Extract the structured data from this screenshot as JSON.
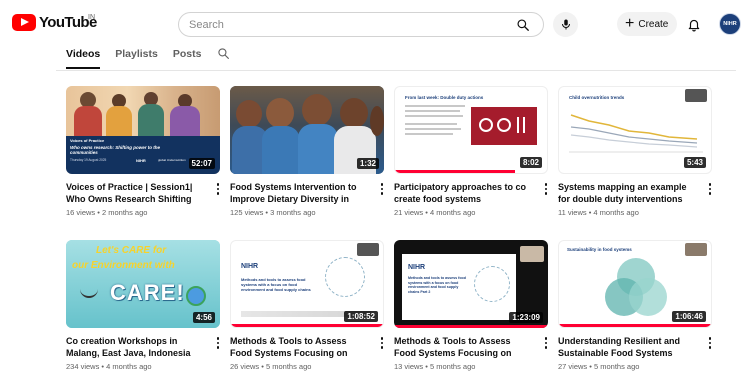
{
  "header": {
    "logo_text": "YouTube",
    "region": "IN",
    "search_placeholder": "Search",
    "create_label": "Create",
    "avatar_text": "NIHR"
  },
  "tabs": [
    {
      "label": "Videos",
      "active": true
    },
    {
      "label": "Playlists",
      "active": false
    },
    {
      "label": "Posts",
      "active": false
    }
  ],
  "videos": [
    {
      "title": "Voices of Practice | Session1| Who Owns Research Shifting Power to...",
      "meta": "16 views • 2 months ago",
      "duration": "52:07"
    },
    {
      "title": "Food Systems Intervention to Improve Dietary Diversity in Surguj...",
      "meta": "125 views • 3 months ago",
      "duration": "1:32"
    },
    {
      "title": "Participatory approaches to co create food systems intervention",
      "meta": "21 views • 4 months ago",
      "duration": "8:02"
    },
    {
      "title": "Systems mapping an example for double duty interventions",
      "meta": "11 views • 4 months ago",
      "duration": "5:43"
    },
    {
      "title": "Co creation Workshops in Malang, East Java, Indonesia",
      "meta": "234 views • 4 months ago",
      "duration": "4:56"
    },
    {
      "title": "Methods & Tools to Assess Food Systems Focusing on Food...",
      "meta": "26 views • 5 months ago",
      "duration": "1:08:52"
    },
    {
      "title": "Methods & Tools to Assess Food Systems Focusing on Food...",
      "meta": "13 views • 5 months ago",
      "duration": "1:23:09"
    },
    {
      "title": "Understanding Resilient and Sustainable Food Systems",
      "meta": "27 views • 5 months ago",
      "duration": "1:06:46"
    }
  ],
  "thumb_text": {
    "t1_heading": "Voices of Practice",
    "t1_question": "Who owns research: Shifting power to the communities",
    "t1_date": "Thursday 19 August 2025",
    "t1_brand": "NIHR",
    "t1_brand2": "global Undernutrition",
    "t3_heading": "From last week: Double duty actions",
    "t4_heading": "Child overnutrition trends",
    "t5_line1": "Let's CARE for",
    "t5_line2": "our Environment with",
    "t5_care": "CARE!",
    "t6_brand": "NIHR",
    "t6_title": "Methods and tools to assess food systems with a focus on food environment and food supply chains",
    "t7_brand": "NIHR",
    "t7_title": "Methods and tools to assess food systems with a focus on food environment and food supply chains Part 2",
    "t8_heading": "Sustainability in food systems"
  },
  "colors": {
    "brand_red": "#ff0000",
    "nihr_navy": "#1c3f7a",
    "progress_red": "#ff0033"
  }
}
